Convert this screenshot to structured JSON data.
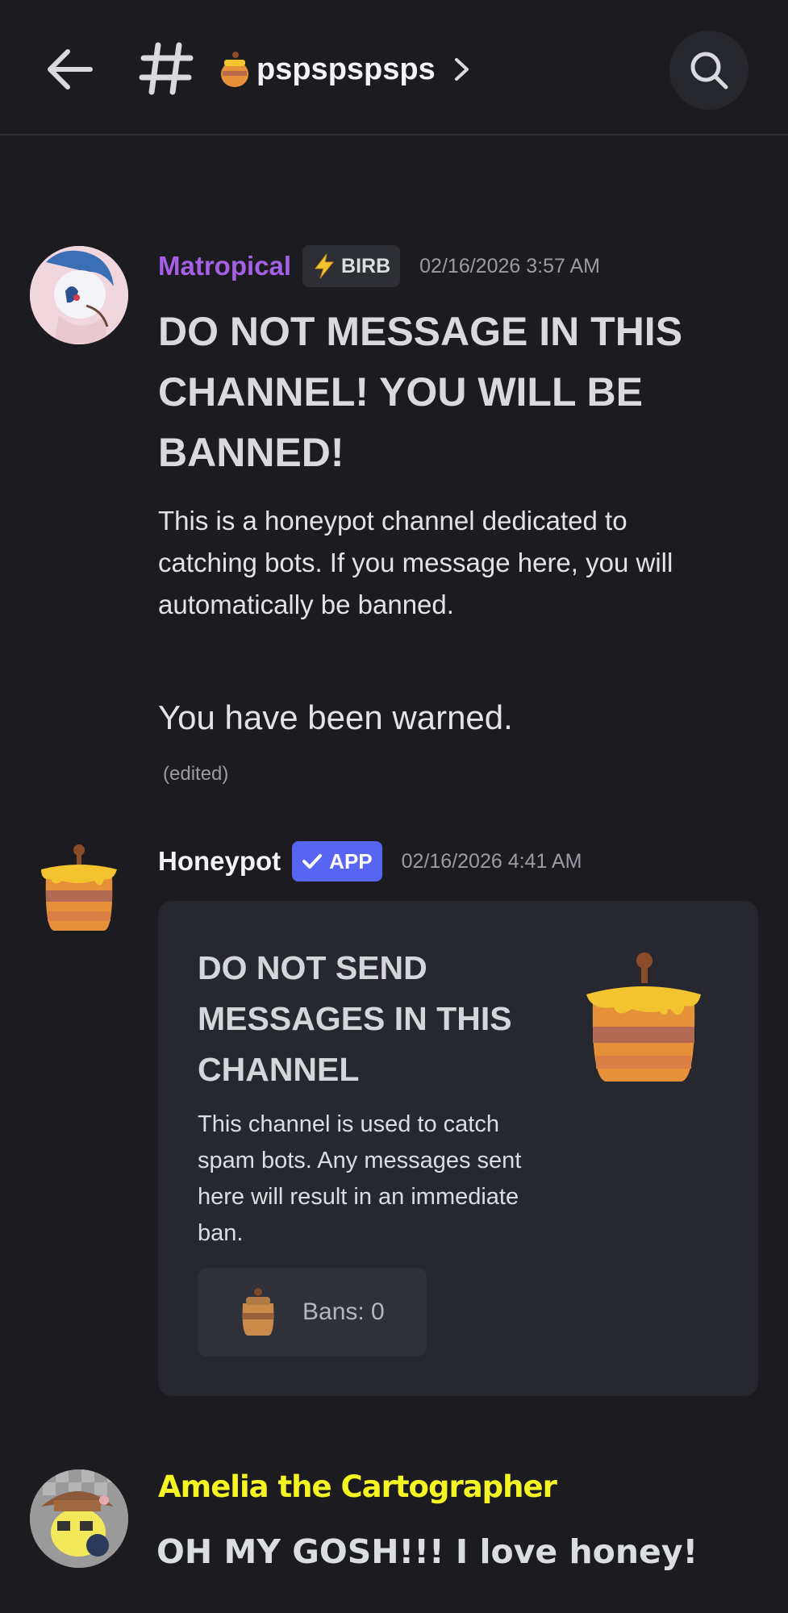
{
  "header": {
    "channel_name": "pspspspsps",
    "back_icon": "arrow-left-icon",
    "channel_type_icon": "hash-icon",
    "channel_emoji": "honey-pot-icon",
    "search_icon": "search-icon"
  },
  "messages": [
    {
      "author": "Matropical",
      "author_color": "#a660e6",
      "tag_icon": "lightning-icon",
      "tag_label": "BIRB",
      "timestamp": "02/16/2026 3:57 AM",
      "heading": "DO NOT MESSAGE IN THIS CHANNEL! YOU WILL BE BANNED!",
      "body": "This is a honeypot channel dedicated to catching bots. If you message here, you will automatically be banned.",
      "warning": "You have been warned.",
      "edited": "(edited)"
    },
    {
      "author": "Honeypot",
      "app_badge": "APP",
      "timestamp": "02/16/2026 4:41 AM",
      "embed": {
        "title": "DO NOT SEND MESSAGES IN THIS CHANNEL",
        "description": "This channel is used to catch spam bots. Any messages sent here will result in an immediate ban.",
        "bans_label": "Bans: 0"
      }
    },
    {
      "author": "Amelia the Cartographer",
      "author_color": "#f5f523",
      "text": "OH MY GOSH!!!  I love honey!"
    }
  ],
  "colors": {
    "background": "#1b1b20",
    "app_badge": "#5865f2",
    "embed_bg": "#27282f"
  }
}
